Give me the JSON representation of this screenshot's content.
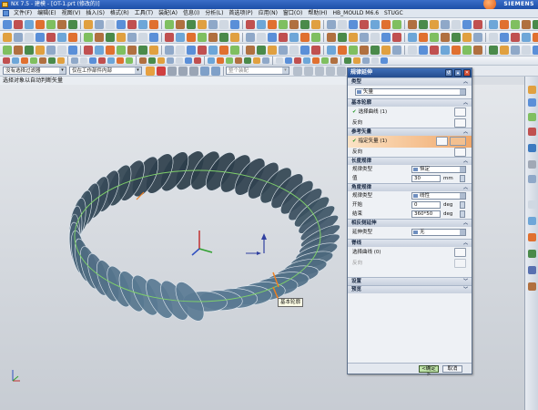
{
  "window": {
    "title": "NX 7.5 - 建模 - [OT-1.prt (修改的)]",
    "brand": "SIEMENS"
  },
  "menubar": {
    "items": [
      "文件(F)",
      "编辑(E)",
      "视图(V)",
      "插入(S)",
      "格式(R)",
      "工具(T)",
      "装配(A)",
      "信息(I)",
      "分析(L)",
      "首选项(P)",
      "应用(N)",
      "窗口(O)",
      "帮助(H)",
      "HB_MOULD M6.6",
      "STUGC"
    ]
  },
  "filterbar": {
    "type_filter": "没有选择过滤器",
    "scope_filter": "仅在工作部件内部",
    "snap_filter": "整个装配"
  },
  "cue": {
    "text": "选择对象以自动判断矢量"
  },
  "tooltip": {
    "text": "基本轮廓"
  },
  "dialog": {
    "title": "规律延伸",
    "type_header": "类型",
    "type_value": "矢量",
    "base_profile_header": "基本轮廓",
    "base_profile_select": "选择曲线 (1)",
    "base_profile_reverse": "反向",
    "ref_vector_header": "参考矢量",
    "ref_vector_select": "指定矢量 (1)",
    "ref_vector_reverse": "反向",
    "length_header": "长度规律",
    "length_type_label": "规律类型",
    "length_type_value": "恒定",
    "length_value_label": "值",
    "length_value": "30",
    "length_unit": "mm",
    "angle_header": "角度规律",
    "angle_type_label": "规律类型",
    "angle_type_value": "线性",
    "angle_start_label": "开始",
    "angle_start_value": "0",
    "angle_end_label": "结束",
    "angle_end_value": "360*50",
    "angle_unit": "deg",
    "opposite_header": "相反侧延伸",
    "extension_type_label": "延伸类型",
    "extension_type_value": "无",
    "spine_header": "脊线",
    "spine_select": "选择曲线 (0)",
    "spine_reverse": "反向",
    "settings_header": "设置",
    "preview_header": "预览",
    "ok_label": "<确定>",
    "cancel_label": "取消"
  },
  "colors": {
    "titlebar": "#244c8e",
    "surface": "#5b7b94",
    "highlight": "#f1a86a"
  }
}
